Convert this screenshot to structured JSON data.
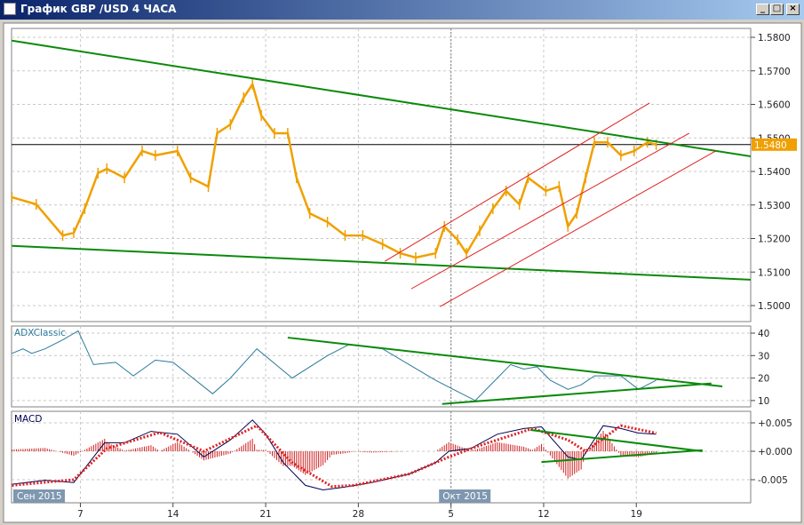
{
  "window": {
    "title": "График GBP /USD  4 ЧАСА",
    "minimize_glyph": "_",
    "maximize_glyph": "□",
    "close_glyph": "×"
  },
  "chart_data": [
    {
      "type": "candlestick-line",
      "panel": "price",
      "ylim": [
        1.496,
        1.583
      ],
      "yticks": [
        "1.5800",
        "1.5700",
        "1.5600",
        "1.5500",
        "1.5400",
        "1.5300",
        "1.5200",
        "1.5100",
        "1.5000"
      ],
      "current_price": "1.5480",
      "colors": {
        "price": "#f0a000",
        "trend": "#0a8a0a",
        "channel": "#e02020",
        "current": "#000000"
      },
      "series": [
        [
          "2015-09-02T08:00Z",
          1.5323
        ],
        [
          "2015-09-04T04:00Z",
          1.5302
        ],
        [
          "2015-09-06T04:00Z",
          1.5209
        ],
        [
          "2015-09-07T00:00Z",
          1.5217
        ],
        [
          "2015-09-07T20:00Z",
          1.5289
        ],
        [
          "2015-09-08T20:00Z",
          1.5395
        ],
        [
          "2015-09-09T12:00Z",
          1.5408
        ],
        [
          "2015-09-10T20:00Z",
          1.5381
        ],
        [
          "2015-09-12T04:00Z",
          1.5461
        ],
        [
          "2015-09-13T04:00Z",
          1.5448
        ],
        [
          "2015-09-14T20:00Z",
          1.5461
        ],
        [
          "2015-09-15T20:00Z",
          1.5381
        ],
        [
          "2015-09-17T04:00Z",
          1.5355
        ],
        [
          "2015-09-17T20:00Z",
          1.5514
        ],
        [
          "2015-09-18T20:00Z",
          1.554
        ],
        [
          "2015-09-19T20:00Z",
          1.562
        ],
        [
          "2015-09-20T12:00Z",
          1.566
        ],
        [
          "2015-09-21T04:00Z",
          1.5567
        ],
        [
          "2015-09-22T04:00Z",
          1.5514
        ],
        [
          "2015-09-23T04:00Z",
          1.5514
        ],
        [
          "2015-09-23T20:00Z",
          1.5381
        ],
        [
          "2015-09-24T20:00Z",
          1.5275
        ],
        [
          "2015-09-26T04:00Z",
          1.5249
        ],
        [
          "2015-09-27T12:00Z",
          1.5209
        ],
        [
          "2015-09-28T20:00Z",
          1.5209
        ],
        [
          "2015-09-30T08:00Z",
          1.5183
        ],
        [
          "2015-10-01T16:00Z",
          1.5156
        ],
        [
          "2015-10-02T20:00Z",
          1.5143
        ],
        [
          "2015-10-04T08:00Z",
          1.5156
        ],
        [
          "2015-10-05T00:00Z",
          1.5236
        ],
        [
          "2015-10-06T00:00Z",
          1.5196
        ],
        [
          "2015-10-06T16:00Z",
          1.5156
        ],
        [
          "2015-10-07T16:00Z",
          1.5223
        ],
        [
          "2015-10-08T16:00Z",
          1.5289
        ],
        [
          "2015-10-09T16:00Z",
          1.5342
        ],
        [
          "2015-10-10T16:00Z",
          1.5302
        ],
        [
          "2015-10-11T08:00Z",
          1.5381
        ],
        [
          "2015-10-12T16:00Z",
          1.5342
        ],
        [
          "2015-10-13T16:00Z",
          1.5355
        ],
        [
          "2015-10-14T08:00Z",
          1.5236
        ],
        [
          "2015-10-15T00:00Z",
          1.5275
        ],
        [
          "2015-10-15T16:00Z",
          1.5381
        ],
        [
          "2015-10-16T08:00Z",
          1.5487
        ],
        [
          "2015-10-17T08:00Z",
          1.5487
        ],
        [
          "2015-10-18T08:00Z",
          1.5448
        ],
        [
          "2015-10-19T08:00Z",
          1.5461
        ],
        [
          "2015-10-20T08:00Z",
          1.5487
        ],
        [
          "2015-10-21T00:00Z",
          1.548
        ]
      ],
      "trendlines": [
        {
          "kind": "trend",
          "points": [
            [
              "2015-09-02T08:00Z",
              1.579
            ],
            [
              "2015-10-28T04:00Z",
              1.5445
            ]
          ]
        },
        {
          "kind": "trend",
          "points": [
            [
              "2015-09-02T08:00Z",
              1.5178
            ],
            [
              "2015-10-28T04:00Z",
              1.5077
            ]
          ]
        },
        {
          "kind": "channel",
          "points": [
            [
              "2015-09-30T12:00Z",
              1.5132
            ],
            [
              "2015-10-20T12:00Z",
              1.5604
            ]
          ]
        },
        {
          "kind": "channel",
          "points": [
            [
              "2015-10-02T12:00Z",
              1.505
            ],
            [
              "2015-10-23T12:00Z",
              1.5514
            ]
          ]
        },
        {
          "kind": "channel",
          "points": [
            [
              "2015-10-04T16:00Z",
              1.4997
            ],
            [
              "2015-10-25T12:00Z",
              1.5461
            ]
          ]
        }
      ]
    },
    {
      "type": "line",
      "panel": "adx",
      "title": "ADXClassic",
      "ylim": [
        7,
        43
      ],
      "yticks": [
        "40",
        "30",
        "20",
        "10"
      ],
      "colors": {
        "line": "#2a7a9a",
        "trend": "#0a8a0a"
      },
      "series": [
        [
          "2015-09-02T08:00Z",
          31
        ],
        [
          "2015-09-03T04:00Z",
          33
        ],
        [
          "2015-09-03T20:00Z",
          31
        ],
        [
          "2015-09-04T20:00Z",
          33
        ],
        [
          "2015-09-06T04:00Z",
          37
        ],
        [
          "2015-09-07T08:00Z",
          41
        ],
        [
          "2015-09-08T12:00Z",
          26
        ],
        [
          "2015-09-10T04:00Z",
          27
        ],
        [
          "2015-09-11T12:00Z",
          21
        ],
        [
          "2015-09-13T04:00Z",
          28
        ],
        [
          "2015-09-14T12:00Z",
          27
        ],
        [
          "2015-09-17T12:00Z",
          13
        ],
        [
          "2015-09-18T20:00Z",
          20
        ],
        [
          "2015-09-20T20:00Z",
          33
        ],
        [
          "2015-09-23T12:00Z",
          20
        ],
        [
          "2015-09-26T04:00Z",
          30
        ],
        [
          "2015-09-27T20:00Z",
          35
        ],
        [
          "2015-09-30T08:00Z",
          33
        ],
        [
          "2015-10-02T08:00Z",
          26
        ],
        [
          "2015-10-04T08:00Z",
          19
        ],
        [
          "2015-10-07T08:00Z",
          10
        ],
        [
          "2015-10-10T00:00Z",
          26
        ],
        [
          "2015-10-11T00:00Z",
          24
        ],
        [
          "2015-10-12T00:00Z",
          25
        ],
        [
          "2015-10-13T00:00Z",
          19
        ],
        [
          "2015-10-14T08:00Z",
          15
        ],
        [
          "2015-10-15T08:00Z",
          17
        ],
        [
          "2015-10-16T08:00Z",
          21
        ],
        [
          "2015-10-18T08:00Z",
          21
        ],
        [
          "2015-10-19T16:00Z",
          15
        ],
        [
          "2015-10-21T00:00Z",
          19
        ]
      ],
      "trendlines": [
        {
          "points": [
            [
              "2015-09-23T04:00Z",
              38
            ],
            [
              "2015-10-26T00:00Z",
              16.3
            ]
          ]
        },
        {
          "points": [
            [
              "2015-10-04T20:00Z",
              8.5
            ],
            [
              "2015-10-25T04:00Z",
              17.6
            ]
          ]
        }
      ]
    },
    {
      "type": "line",
      "panel": "macd",
      "title": "MACD",
      "ylim": [
        -0.0078,
        0.0072
      ],
      "yticks": [
        "+0.005",
        "+0.000",
        "-0.005"
      ],
      "colors": {
        "main": "#000050",
        "signal": "#e02020",
        "histogram": "#d02020",
        "trend": "#0a8a0a"
      },
      "main": [
        [
          "2015-09-02T08:00Z",
          -0.0058
        ],
        [
          "2015-09-04T20:00Z",
          -0.0051
        ],
        [
          "2015-09-07T00:00Z",
          -0.0055
        ],
        [
          "2015-09-08T04:00Z",
          -0.002
        ],
        [
          "2015-09-09T08:00Z",
          0.0015
        ],
        [
          "2015-09-10T20:00Z",
          0.0015
        ],
        [
          "2015-09-12T20:00Z",
          0.0035
        ],
        [
          "2015-09-14T20:00Z",
          0.003
        ],
        [
          "2015-09-16T20:00Z",
          -0.001
        ],
        [
          "2015-09-18T20:00Z",
          0.002
        ],
        [
          "2015-09-20T12:00Z",
          0.0055
        ],
        [
          "2015-09-21T12:00Z",
          0.003
        ],
        [
          "2015-09-22T20:00Z",
          -0.002
        ],
        [
          "2015-09-24T12:00Z",
          -0.006
        ],
        [
          "2015-09-25T20:00Z",
          -0.0068
        ],
        [
          "2015-09-27T12:00Z",
          -0.0063
        ],
        [
          "2015-09-29T12:00Z",
          -0.0055
        ],
        [
          "2015-10-02T08:00Z",
          -0.004
        ],
        [
          "2015-10-04T08:00Z",
          -0.002
        ],
        [
          "2015-10-05T08:00Z",
          0.0
        ],
        [
          "2015-10-07T00:00Z",
          0.0005
        ],
        [
          "2015-10-09T00:00Z",
          0.003
        ],
        [
          "2015-10-11T00:00Z",
          0.004
        ],
        [
          "2015-10-12T08:00Z",
          0.0043
        ],
        [
          "2015-10-14T08:00Z",
          -0.001
        ],
        [
          "2015-10-15T08:00Z",
          -0.0015
        ],
        [
          "2015-10-17T00:00Z",
          0.0045
        ],
        [
          "2015-10-18T08:00Z",
          0.004
        ],
        [
          "2015-10-19T16:00Z",
          0.0032
        ],
        [
          "2015-10-21T00:00Z",
          0.003
        ]
      ],
      "signal": [
        [
          "2015-09-02T08:00Z",
          -0.006
        ],
        [
          "2015-09-07T00:00Z",
          -0.005
        ],
        [
          "2015-09-09T12:00Z",
          0.0005
        ],
        [
          "2015-09-13T12:00Z",
          0.0033
        ],
        [
          "2015-09-16T20:00Z",
          0.0
        ],
        [
          "2015-09-20T20:00Z",
          0.0045
        ],
        [
          "2015-09-23T12:00Z",
          -0.002
        ],
        [
          "2015-09-26T12:00Z",
          -0.0062
        ],
        [
          "2015-09-28T04:00Z",
          -0.006
        ],
        [
          "2015-10-02T08:00Z",
          -0.004
        ],
        [
          "2015-10-05T08:00Z",
          -0.001
        ],
        [
          "2015-10-07T16:00Z",
          0.001
        ],
        [
          "2015-10-11T16:00Z",
          0.004
        ],
        [
          "2015-10-14T08:00Z",
          0.002
        ],
        [
          "2015-10-15T16:00Z",
          0.0
        ],
        [
          "2015-10-18T08:00Z",
          0.0045
        ],
        [
          "2015-10-21T00:00Z",
          0.0032
        ]
      ],
      "trendlines": [
        {
          "points": [
            [
              "2015-10-11T12:00Z",
              0.00375
            ],
            [
              "2015-10-24T12:00Z",
              0.0
            ]
          ]
        },
        {
          "points": [
            [
              "2015-10-12T08:00Z",
              -0.0019
            ],
            [
              "2015-10-24T12:00Z",
              0.0002
            ]
          ]
        }
      ]
    }
  ],
  "x_axis": {
    "ticks": [
      {
        "label": "7",
        "date": "2015-09-07T12:00Z"
      },
      {
        "label": "14",
        "date": "2015-09-14T12:00Z"
      },
      {
        "label": "21",
        "date": "2015-09-21T12:00Z"
      },
      {
        "label": "28",
        "date": "2015-09-28T12:00Z"
      },
      {
        "label": "5",
        "date": "2015-10-05T12:00Z"
      },
      {
        "label": "12",
        "date": "2015-10-12T12:00Z"
      },
      {
        "label": "19",
        "date": "2015-10-19T12:00Z"
      }
    ],
    "months": [
      {
        "label": "Сен 2015",
        "date": "2015-09-01T00:00Z"
      },
      {
        "label": "Окт 2015",
        "date": "2015-10-05T00:00Z"
      }
    ],
    "month_separator_date": "2015-10-05T12:00Z"
  }
}
